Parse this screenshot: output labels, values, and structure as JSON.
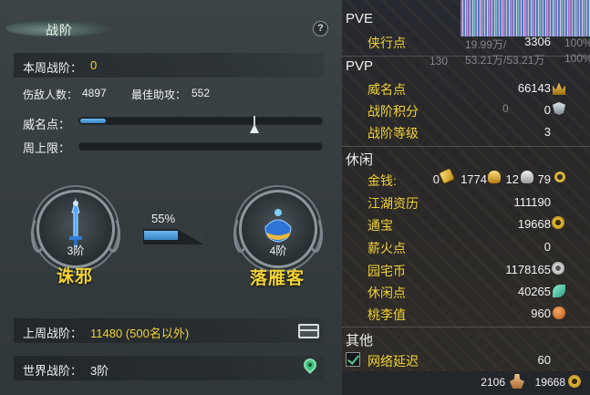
{
  "header": {
    "title": "战阶",
    "help_label": "?"
  },
  "weekly": {
    "label": "本周战阶：",
    "value": "0"
  },
  "stats": {
    "kills_label": "伤敌人数：",
    "kills_value": "4897",
    "assist_label": "最佳助攻：",
    "assist_value": "552"
  },
  "prestige": {
    "label": "威名点：",
    "progress": 0.105
  },
  "weekly_cap": {
    "label": "周上限：",
    "progress": 0
  },
  "emblems": [
    {
      "level": "3阶",
      "name": "诛邪"
    },
    {
      "level": "4阶",
      "name": "落雁客"
    }
  ],
  "progress_percent": "55%",
  "progress_value": 0.55,
  "last_week": {
    "label": "上周战阶：",
    "value": "11480 (500名以外)"
  },
  "world": {
    "label": "世界战阶：",
    "value": "3阶"
  },
  "icons": {
    "chest": "chest-icon",
    "pin": "location-pin-icon",
    "help": "help-icon",
    "gold": "gold-ingot-icon",
    "silver": "silver-ingot-icon",
    "coin": "copper-coin-icon",
    "peach": "peach-icon",
    "leaf": "leaf-icon",
    "crown": "crown-icon",
    "shield": "shield-icon"
  },
  "colors": {
    "accent_yellow": "#f1d234",
    "progress_blue": "#4a9ee0",
    "panel_bg": "#363d41"
  },
  "right": {
    "pve": {
      "title": "PVE",
      "items": [
        {
          "label": "侠行点",
          "value": "3306"
        }
      ]
    },
    "pvp": {
      "title": "PVP",
      "items": [
        {
          "label": "威名点",
          "value": "66143"
        },
        {
          "label": "战阶积分",
          "value": "0"
        },
        {
          "label": "战阶等级",
          "value": "3"
        }
      ]
    },
    "leisure": {
      "title": "休闲",
      "money_label": "金钱:",
      "money": {
        "gold_ingot": "0",
        "gold": "1774",
        "silver": "12",
        "copper": "79"
      },
      "items": [
        {
          "label": "江湖资历",
          "value": "111190"
        },
        {
          "label": "通宝",
          "value": "19668"
        },
        {
          "label": "薪火点",
          "value": "0"
        },
        {
          "label": "园宅币",
          "value": "1178165"
        },
        {
          "label": "休闲点",
          "value": "40265"
        },
        {
          "label": "桃李值",
          "value": "960"
        }
      ]
    },
    "other": {
      "title": "其他",
      "items": [
        {
          "label": "网络延迟",
          "value": "60",
          "checked": true
        }
      ]
    },
    "bottom": {
      "left_value": "2106",
      "right_value": "19668"
    },
    "background_ghost_text": {
      "a": "19.99万/",
      "b": "100%",
      "c": "53.21万/53.21万",
      "d": "100%",
      "e": "130",
      "f": "0"
    }
  }
}
